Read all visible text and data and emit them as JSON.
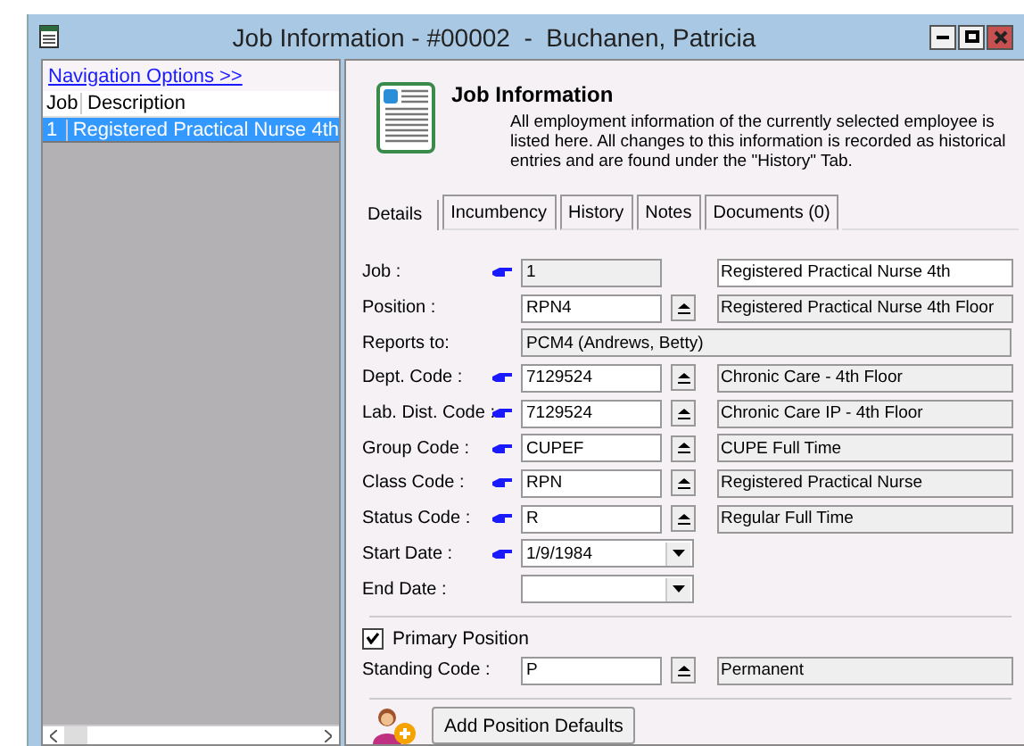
{
  "window": {
    "title": "Job Information - #00002  -  Buchanen, Patricia"
  },
  "navigation": {
    "link": "Navigation Options >>",
    "columns": [
      "Job",
      "Description"
    ],
    "rows": [
      {
        "cells": [
          "1",
          "Registered Practical Nurse 4th"
        ],
        "selected": true
      }
    ]
  },
  "header": {
    "title": "Job Information",
    "description": "All employment information of the currently selected employee is listed here. All changes to this information is recorded as historical entries and are found under the \"History\" Tab."
  },
  "tabs": [
    {
      "label": "Details",
      "selected": true
    },
    {
      "label": "Incumbency",
      "selected": false
    },
    {
      "label": "History",
      "selected": false
    },
    {
      "label": "Notes",
      "selected": false
    },
    {
      "label": "Documents (0)",
      "selected": false
    }
  ],
  "fields": [
    {
      "kind": "plain",
      "label": "Job :",
      "pointer": true,
      "code": "1",
      "code_readonly": true,
      "description": "Registered Practical Nurse 4th",
      "description_readonly": false
    },
    {
      "kind": "lookup",
      "label": "Position :",
      "pointer": false,
      "code": "RPN4",
      "code_readonly": false,
      "description": "Registered Practical Nurse 4th Floor",
      "description_readonly": true
    },
    {
      "kind": "wide",
      "label": "Reports to:",
      "pointer": false,
      "code": "PCM4 (Andrews, Betty)",
      "code_readonly": true
    },
    {
      "kind": "lookup",
      "label": "Dept. Code :",
      "pointer": true,
      "code": "7129524",
      "code_readonly": false,
      "description": "Chronic Care - 4th Floor",
      "description_readonly": true
    },
    {
      "kind": "lookup",
      "label": "Lab. Dist. Code :",
      "pointer": true,
      "code": "7129524",
      "code_readonly": false,
      "description": "Chronic Care IP - 4th Floor",
      "description_readonly": true
    },
    {
      "kind": "lookup",
      "label": "Group Code :",
      "pointer": true,
      "code": "CUPEF",
      "code_readonly": false,
      "description": "CUPE Full Time",
      "description_readonly": true
    },
    {
      "kind": "lookup",
      "label": "Class Code :",
      "pointer": true,
      "code": "RPN",
      "code_readonly": false,
      "description": "Registered Practical Nurse",
      "description_readonly": true
    },
    {
      "kind": "lookup",
      "label": "Status Code :",
      "pointer": true,
      "code": "R",
      "code_readonly": false,
      "description": "Regular Full Time",
      "description_readonly": true
    },
    {
      "kind": "date",
      "label": "Start Date :",
      "pointer": true,
      "code": "1/9/1984",
      "code_readonly": false
    },
    {
      "kind": "date",
      "label": "End Date :",
      "pointer": false,
      "code_readonly": false
    }
  ],
  "primary_position": {
    "label": "Primary Position",
    "checked": true
  },
  "standing_fields": [
    {
      "kind": "lookup",
      "label": "Standing Code :",
      "pointer": false,
      "code": "P",
      "code_readonly": false,
      "description": "Permanent",
      "description_readonly": true
    }
  ],
  "add_button": {
    "label": "Add Position Defaults"
  }
}
